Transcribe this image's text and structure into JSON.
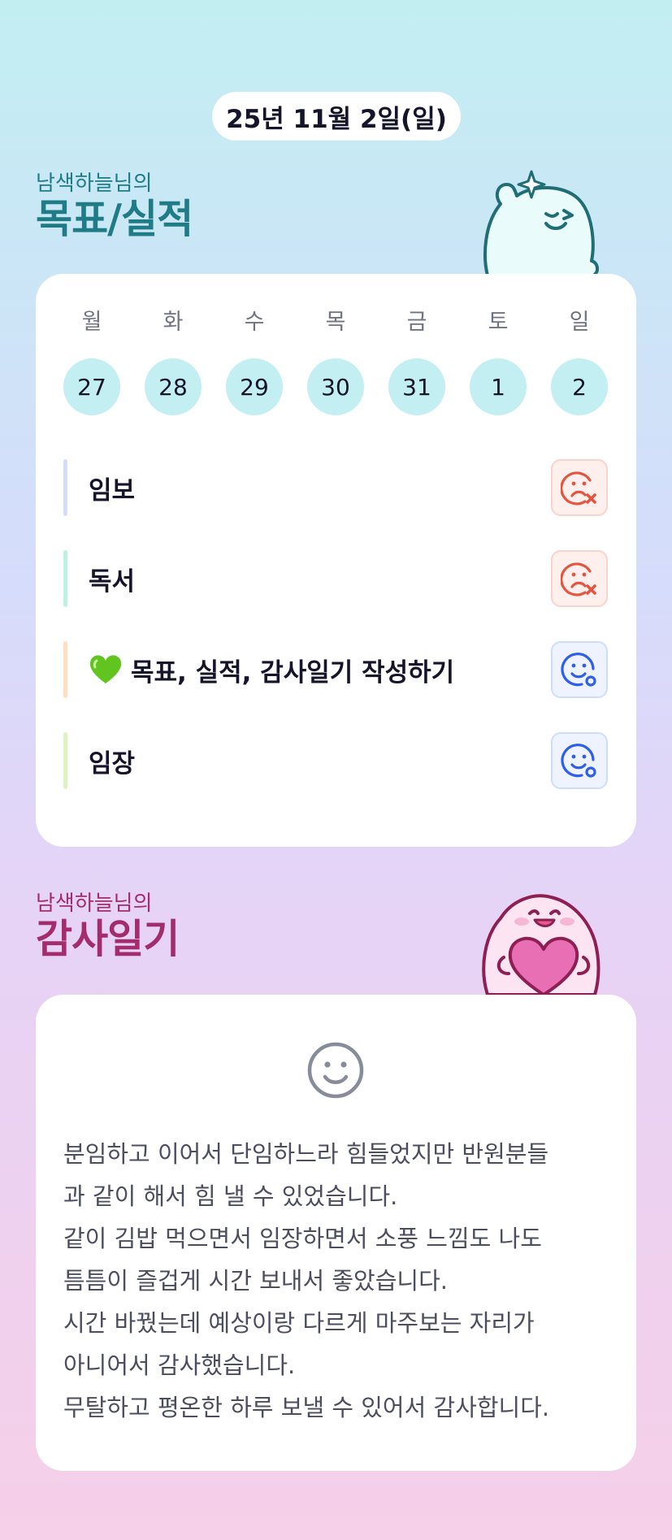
{
  "date_label": "25년 11월 2일(일)",
  "goals_section": {
    "subtitle": "남색하늘님의",
    "title": "목표/실적"
  },
  "week": [
    {
      "day": "월",
      "date": "27"
    },
    {
      "day": "화",
      "date": "28"
    },
    {
      "day": "수",
      "date": "29"
    },
    {
      "day": "목",
      "date": "30"
    },
    {
      "day": "금",
      "date": "31"
    },
    {
      "day": "토",
      "date": "1"
    },
    {
      "day": "일",
      "date": "2"
    }
  ],
  "tasks": [
    {
      "label": "임보",
      "bar_color": "#d4dcf8",
      "status": "fail"
    },
    {
      "label": "독서",
      "bar_color": "#bff0e4",
      "status": "fail"
    },
    {
      "label": "목표, 실적, 감사일기 작성하기",
      "bar_color": "#fde0c2",
      "status": "done",
      "emoji": "green-heart"
    },
    {
      "label": "임장",
      "bar_color": "#def3c0",
      "status": "done"
    }
  ],
  "diary_section": {
    "subtitle": "남색하늘님의",
    "title": "감사일기"
  },
  "diary_lines": [
    "분임하고 이어서 단임하느라 힘들었지만 반원분들",
    "과 같이 해서 힘 낼 수 있었습니다.",
    "같이 김밥 먹으면서 임장하면서 소풍 느낌도 나도",
    "틈틈이 즐겁게 시간 보내서 좋았습니다.",
    "시간 바꿨는데 예상이랑 다르게 마주보는 자리가",
    "아니어서 감사했습니다.",
    "무탈하고 평온한 하루 보낼 수 있어서 감사합니다."
  ],
  "colors": {
    "fail_icon": "#e25640",
    "done_icon": "#2f5ee8",
    "day_circle": "#c3eff3",
    "goals_title": "#1f7c86",
    "diary_title": "#a32d6c"
  },
  "icons": {
    "fail": "sad-face-x-icon",
    "done": "smile-face-check-icon",
    "diary_mood": "smile-face-icon"
  }
}
